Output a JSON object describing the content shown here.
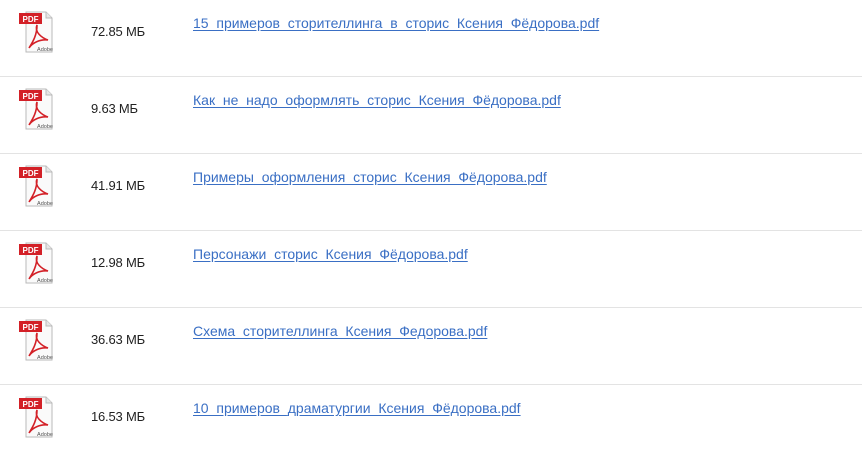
{
  "files": [
    {
      "icon": "pdf-adobe-icon",
      "badge": "PDF",
      "brand": "Adobe",
      "size": "72.85 МБ",
      "name": "15_примеров_сторителлинга_в_сторис_Ксения_Фёдорова.pdf"
    },
    {
      "icon": "pdf-adobe-icon",
      "badge": "PDF",
      "brand": "Adobe",
      "size": "9.63 МБ",
      "name": "Как_не_надо_оформлять_сторис_Ксения_Фёдорова.pdf"
    },
    {
      "icon": "pdf-adobe-icon",
      "badge": "PDF",
      "brand": "Adobe",
      "size": "41.91 МБ",
      "name": "Примеры_оформления_сторис_Ксения_Фёдорова.pdf"
    },
    {
      "icon": "pdf-adobe-icon",
      "badge": "PDF",
      "brand": "Adobe",
      "size": "12.98 МБ",
      "name": "Персонажи_сторис_Ксения_Фёдорова.pdf"
    },
    {
      "icon": "pdf-adobe-icon",
      "badge": "PDF",
      "brand": "Adobe",
      "size": "36.63 МБ",
      "name": "Схема_сторителлинга_Ксения_Федорова.pdf"
    },
    {
      "icon": "pdf-adobe-icon",
      "badge": "PDF",
      "brand": "Adobe",
      "size": "16.53 МБ",
      "name": "10_примеров_драматургии_Ксения_Фёдорова.pdf"
    }
  ],
  "colors": {
    "link": "#3a6fc4",
    "pdf_red": "#d32027",
    "divider": "#e3e3e3"
  }
}
